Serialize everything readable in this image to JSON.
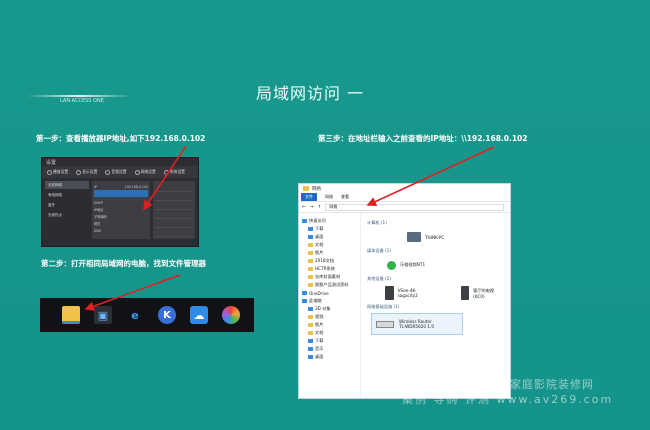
{
  "slide": {
    "title": "局域网访问  一",
    "subtitle": "LAN ACCESS ONE",
    "step1": "第一步：查看播放器IP地址,如下192.168.0.102",
    "step2": "第二步：打开相同局域网的电脑，找到文件管理器",
    "step3": "第三步：在地址栏输入之前查看的IP地址：\\\\192.168.0.102",
    "accent_color": "#e02020",
    "background_color": "#17968b"
  },
  "player": {
    "header": "设置",
    "tabs": [
      "播放设置",
      "显示设置",
      "音频设置",
      "网络设置",
      "系统设置"
    ],
    "left_items": [
      "无线网络",
      "有线网络",
      "蓝牙",
      "无线热点"
    ],
    "mid_rows": [
      {
        "label": "IP",
        "value": "192.168.0.102"
      },
      {
        "label": "DHCP",
        "value": ""
      },
      {
        "label": "IP地址",
        "value": ""
      },
      {
        "label": "子网掩码",
        "value": ""
      },
      {
        "label": "网关",
        "value": ""
      },
      {
        "label": "DNS",
        "value": ""
      }
    ]
  },
  "taskbar": {
    "icons": [
      "file-explorer-icon",
      "store-icon",
      "edge-icon",
      "kodi-icon",
      "cloud-icon",
      "photos-icon"
    ]
  },
  "explorer": {
    "title": "网络",
    "ribbon": [
      "文件",
      "网络",
      "查看"
    ],
    "address": "网络",
    "sidebar": [
      {
        "label": "快速访问",
        "indent": false
      },
      {
        "label": "下载",
        "indent": true
      },
      {
        "label": "桌面",
        "indent": true
      },
      {
        "label": "文档",
        "indent": true
      },
      {
        "label": "图片",
        "indent": true
      },
      {
        "label": "2018文档",
        "indent": true
      },
      {
        "label": "HCTR系统",
        "indent": true
      },
      {
        "label": "仓库封面素材",
        "indent": true
      },
      {
        "label": "图影产品测试资料",
        "indent": true
      },
      {
        "label": "OneDrive",
        "indent": false
      },
      {
        "label": "此电脑",
        "indent": false
      },
      {
        "label": "3D 对象",
        "indent": true
      },
      {
        "label": "视频",
        "indent": true
      },
      {
        "label": "图片",
        "indent": true
      },
      {
        "label": "文档",
        "indent": true
      },
      {
        "label": "下载",
        "indent": true
      },
      {
        "label": "音乐",
        "indent": true
      },
      {
        "label": "桌面",
        "indent": true
      }
    ],
    "sections": {
      "computers": "计算机 (1)",
      "media": "媒体设备 (1)",
      "other": "其他设备 (2)",
      "network": "网络基础设施 (1)"
    },
    "devices": {
      "pc": "THINK-PC",
      "media": "乐橙视频NT1",
      "other1": "VSee-4K-sagacity2",
      "other2": "客厅的电视(0C0)",
      "router_name": "Wireless Router",
      "router_model": "TL-WDR5620 1.0"
    }
  },
  "watermark": {
    "line1": "阿强家庭影院导购与家庭影院装修网",
    "line2": "案例 导购 评测   www.av269.com"
  }
}
